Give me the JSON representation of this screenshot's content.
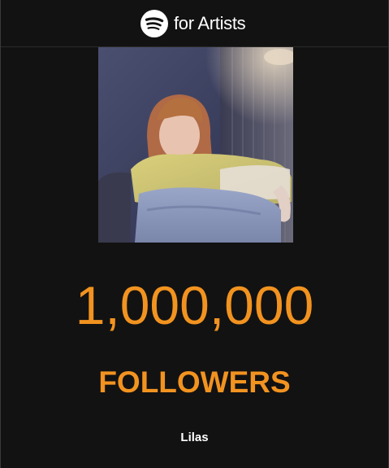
{
  "header": {
    "logo_icon": "spotify-logo-icon",
    "brand_text": "for Artists"
  },
  "artist_photo": {
    "icon": "artist-photo"
  },
  "milestone": {
    "count": "1,000,000",
    "label": "FOLLOWERS"
  },
  "artist": {
    "name": "Lilas"
  },
  "colors": {
    "background": "#121212",
    "accent": "#f29320",
    "text": "#ffffff"
  }
}
